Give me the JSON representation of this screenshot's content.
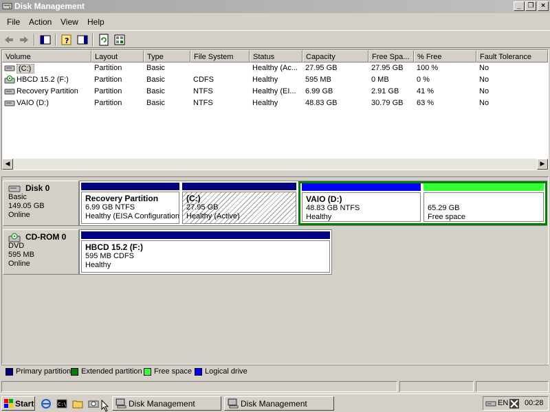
{
  "window": {
    "title": "Disk Management"
  },
  "menu": [
    "File",
    "Action",
    "View",
    "Help"
  ],
  "list": {
    "columns": [
      "Volume",
      "Layout",
      "Type",
      "File System",
      "Status",
      "Capacity",
      "Free Spa...",
      "% Free",
      "Fault Tolerance"
    ],
    "rows": [
      {
        "volume": "(C:)",
        "layout": "Partition",
        "type": "Basic",
        "fs": "",
        "status": "Healthy (Ac...",
        "capacity": "27.95 GB",
        "free": "27.95 GB",
        "pct": "100 %",
        "fault": "No"
      },
      {
        "volume": "HBCD 15.2 (F:)",
        "layout": "Partition",
        "type": "Basic",
        "fs": "CDFS",
        "status": "Healthy",
        "capacity": "595 MB",
        "free": "0 MB",
        "pct": "0 %",
        "fault": "No"
      },
      {
        "volume": "Recovery Partition",
        "layout": "Partition",
        "type": "Basic",
        "fs": "NTFS",
        "status": "Healthy (EI...",
        "capacity": "6.99 GB",
        "free": "2.91 GB",
        "pct": "41 %",
        "fault": "No"
      },
      {
        "volume": "VAIO (D:)",
        "layout": "Partition",
        "type": "Basic",
        "fs": "NTFS",
        "status": "Healthy",
        "capacity": "48.83 GB",
        "free": "30.79 GB",
        "pct": "63 %",
        "fault": "No"
      }
    ]
  },
  "disks": [
    {
      "name": "Disk 0",
      "kind": "Basic",
      "size": "149.05 GB",
      "state": "Online",
      "partitions": [
        {
          "name": "Recovery Partition",
          "size": "6.99 GB NTFS",
          "status": "Healthy (EISA Configuration"
        },
        {
          "name": "(C:)",
          "size": "27.95 GB",
          "status": "Healthy (Active)"
        },
        {
          "name": "VAIO  (D:)",
          "size": "48.83 GB NTFS",
          "status": "Healthy"
        },
        {
          "name": "",
          "size": "65.29 GB",
          "status": "Free space"
        }
      ]
    },
    {
      "name": "CD-ROM 0",
      "kind": "DVD",
      "size": "595 MB",
      "state": "Online",
      "partitions": [
        {
          "name": "HBCD 15.2  (F:)",
          "size": "595 MB CDFS",
          "status": "Healthy"
        }
      ]
    }
  ],
  "legend": [
    {
      "label": "Primary partition",
      "color": "#000080"
    },
    {
      "label": "Extended partition",
      "color": "#008000"
    },
    {
      "label": "Free space",
      "color": "#33ff33"
    },
    {
      "label": "Logical drive",
      "color": "#0000ff"
    }
  ],
  "taskbar": {
    "start": "Start",
    "tasks": [
      "Disk Management",
      "Disk Management"
    ],
    "lang": "EN",
    "clock": "00:28"
  }
}
